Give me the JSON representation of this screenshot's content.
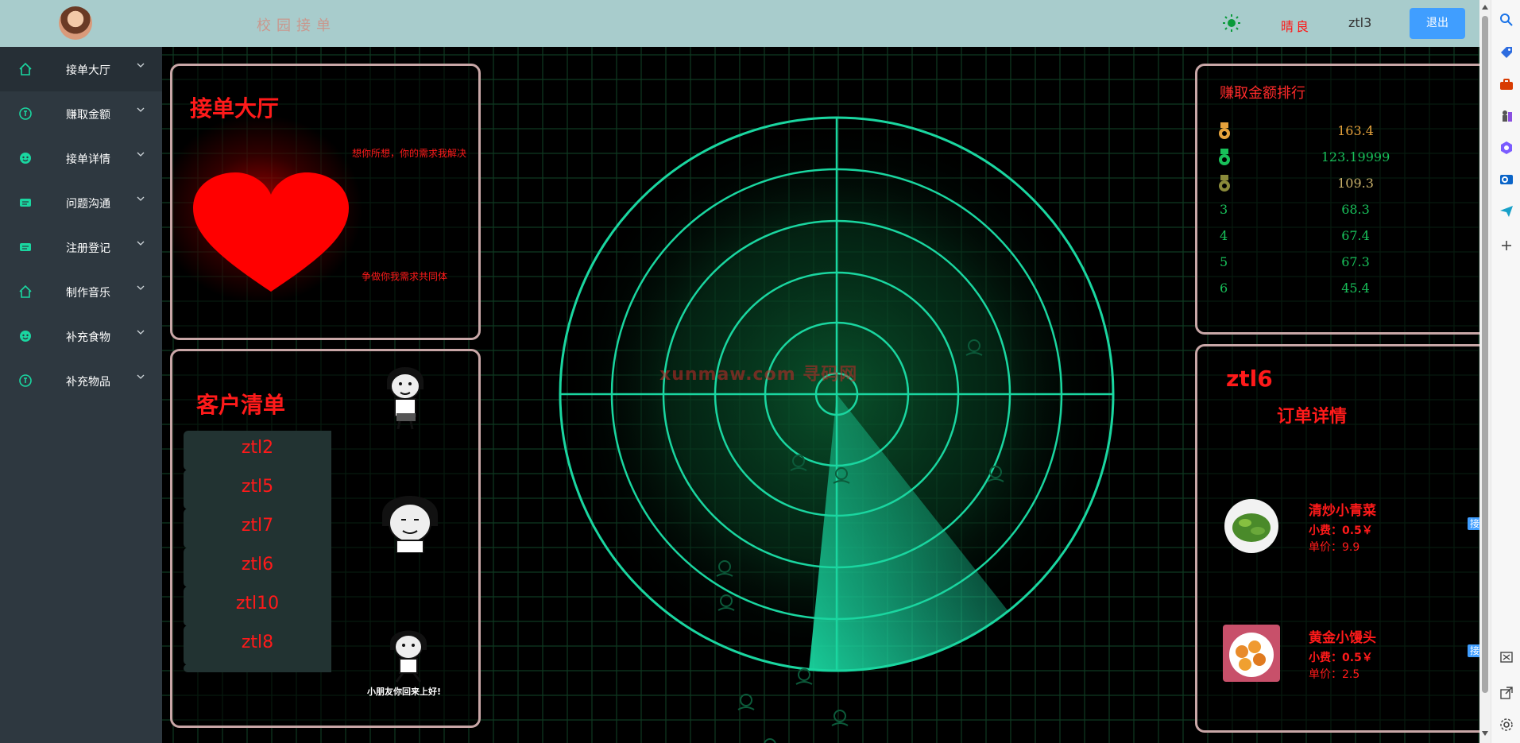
{
  "header": {
    "app_title": "校园接单",
    "weather": "晴良",
    "username": "ztl3",
    "logout_label": "退出"
  },
  "sidebar": {
    "items": [
      {
        "label": "接单大厅",
        "icon": "home-icon"
      },
      {
        "label": "赚取金额",
        "icon": "coin-icon"
      },
      {
        "label": "接单详情",
        "icon": "smile-icon"
      },
      {
        "label": "问题沟通",
        "icon": "ticket-icon"
      },
      {
        "label": "注册登记",
        "icon": "ticket-icon"
      },
      {
        "label": "制作音乐",
        "icon": "home-icon"
      },
      {
        "label": "补充食物",
        "icon": "smile-icon"
      },
      {
        "label": "补充物品",
        "icon": "coin-icon"
      }
    ]
  },
  "hall": {
    "title": "接单大厅",
    "slogan1": "想你所想，你的需求我解决",
    "slogan2": "争做你我需求共同体"
  },
  "clients": {
    "title": "客户清单",
    "items": [
      "ztl2",
      "ztl5",
      "ztl7",
      "ztl6",
      "ztl10",
      "ztl8"
    ],
    "meme_caption": "小朋友你回来上好!"
  },
  "ranking": {
    "title": "赚取金额排行",
    "rows": [
      {
        "rank": "",
        "medal": "gold",
        "amount": "163.4"
      },
      {
        "rank": "",
        "medal": "green",
        "amount": "123.19999"
      },
      {
        "rank": "",
        "medal": "olive",
        "amount": "109.3"
      },
      {
        "rank": "3",
        "medal": "",
        "amount": "68.3"
      },
      {
        "rank": "4",
        "medal": "",
        "amount": "67.4"
      },
      {
        "rank": "5",
        "medal": "",
        "amount": "67.3"
      },
      {
        "rank": "6",
        "medal": "",
        "amount": "45.4"
      }
    ]
  },
  "order": {
    "user": "ztl6",
    "title": "订单详情",
    "take_label": "接单",
    "dishes": [
      {
        "name": "清炒小青菜",
        "fee": "小费：0.5￥",
        "price": "单价：9.9"
      },
      {
        "name": "黄金小馒头",
        "fee": "小费：0.5￥",
        "price": "单价：2.5"
      }
    ]
  },
  "watermark": "xunmaw.com 寻码网",
  "colors": {
    "accent_red": "#ff1a1a",
    "radar_green": "#1ad6a0",
    "header_bg": "#a8cccc",
    "sidebar_bg": "#2e3840",
    "logout_blue": "#409eff",
    "rank_gold": "#e6a23c",
    "rank_green": "#18c05a"
  }
}
